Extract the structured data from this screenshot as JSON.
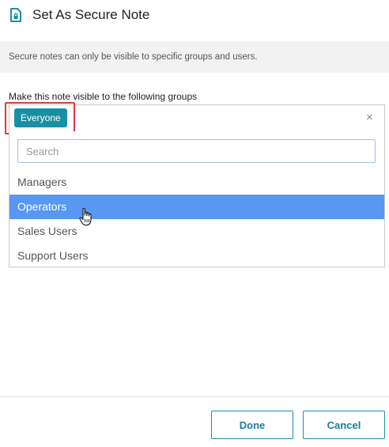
{
  "dialog": {
    "title": "Set As Secure Note",
    "title_icon": "secure-note-icon",
    "accent_color": "#1a8fa4",
    "info_text": "Secure notes can only be visible to specific groups and users."
  },
  "groups_field": {
    "label": "Make this note visible to the following groups",
    "selected_tags": [
      "Everyone"
    ],
    "clear_symbol": "×",
    "search_placeholder": "Search",
    "search_value": "",
    "options": [
      "Managers",
      "Operators",
      "Sales Users",
      "Support Users"
    ],
    "highlighted_option": "Operators",
    "highlight_color": "#5897f2",
    "annotation_frame_color": "#e0393e"
  },
  "footer": {
    "done_label": "Done",
    "cancel_label": "Cancel"
  }
}
